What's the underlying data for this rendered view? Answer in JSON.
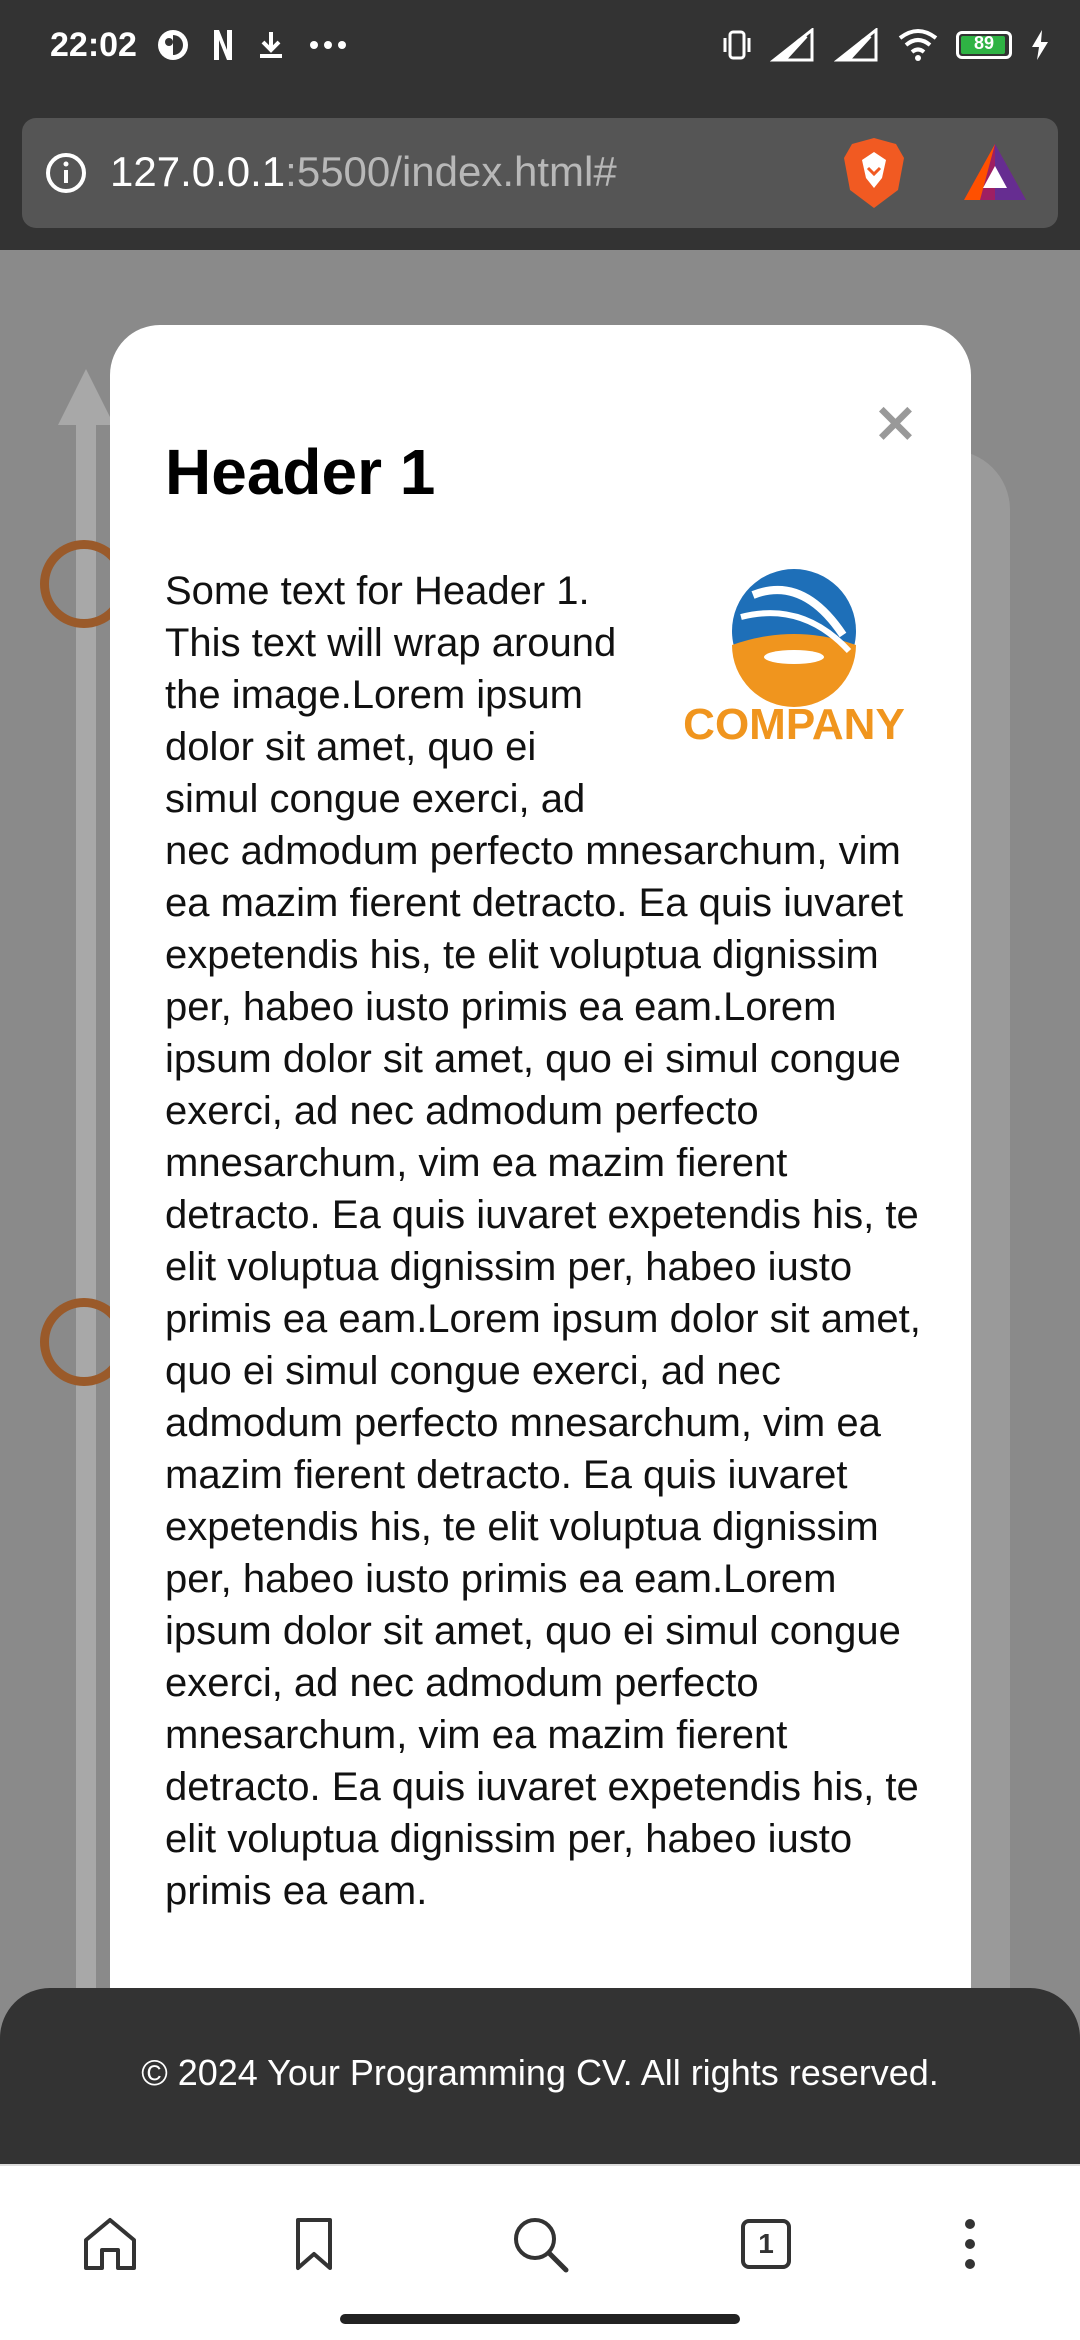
{
  "status_bar": {
    "time": "22:02",
    "battery": "89",
    "left_icons": [
      "camera-app-icon",
      "n-app-icon",
      "download-icon",
      "more-dots-icon"
    ],
    "right_icons": [
      "vibrate-icon",
      "signal-1-icon",
      "signal-2-icon",
      "wifi-icon",
      "battery-icon",
      "charging-icon"
    ]
  },
  "browser": {
    "url_host": "127.0.0.1",
    "url_path": ":5500/index.html#"
  },
  "modal": {
    "title": "Header 1",
    "close_symbol": "×",
    "logo_text": "COMPANY",
    "body": "Some text for Header 1. This text will wrap around the image.Lorem ipsum dolor sit amet, quo ei simul congue exerci, ad nec admodum perfecto mnesarchum, vim ea mazim fierent detracto. Ea quis iuvaret expetendis his, te elit voluptua dignissim per, habeo iusto primis ea eam.Lorem ipsum dolor sit amet, quo ei simul congue exerci, ad nec admodum perfecto mnesarchum, vim ea mazim fierent detracto. Ea quis iuvaret expetendis his, te elit voluptua dignissim per, habeo iusto primis ea eam.Lorem ipsum dolor sit amet, quo ei simul congue exerci, ad nec admodum perfecto mnesarchum, vim ea mazim fierent detracto. Ea quis iuvaret expetendis his, te elit voluptua dignissim per, habeo iusto primis ea eam.Lorem ipsum dolor sit amet, quo ei simul congue exerci, ad nec admodum perfecto mnesarchum, vim ea mazim fierent detracto. Ea quis iuvaret expetendis his, te elit voluptua dignissim per, habeo iusto primis ea eam."
  },
  "footer": {
    "text": "© 2024 Your Programming CV. All rights reserved."
  },
  "bottom_nav": {
    "tab_count": "1",
    "icons": [
      "home-icon",
      "bookmark-icon",
      "search-icon",
      "tabs-icon",
      "menu-icon"
    ]
  },
  "colors": {
    "accent_orange": "#f0951e",
    "logo_blue": "#1e6fb8",
    "timeline_circle": "#9a5a2a",
    "battery_green": "#2fb344"
  }
}
